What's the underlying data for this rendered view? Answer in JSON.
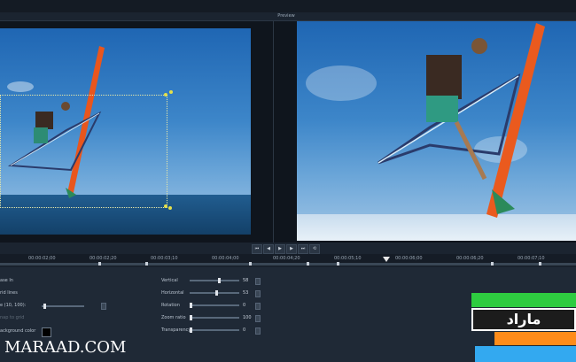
{
  "header": {
    "preview_label": "Preview"
  },
  "transport": {
    "buttons": [
      {
        "name": "go-to-start-button",
        "glyph": "⏮"
      },
      {
        "name": "prev-frame-button",
        "glyph": "◀"
      },
      {
        "name": "play-button",
        "glyph": "▶"
      },
      {
        "name": "next-frame-button",
        "glyph": "▶"
      },
      {
        "name": "go-to-end-button",
        "glyph": "⏭"
      },
      {
        "name": "loop-button",
        "glyph": "⟲"
      }
    ]
  },
  "timeline": {
    "ticks": [
      "00:00:02;00",
      "00:00:02;20",
      "00:00:03;10",
      "00:00:04;00",
      "00:00:04;20",
      "00:00:05;10",
      "00:00:06;00",
      "00:00:06;20",
      "00:00:07;10"
    ]
  },
  "left_options": {
    "ease_in": "ase In",
    "grid_lines": "rid lines",
    "grid_size": "e (10, 100):",
    "snap": "nap to grid",
    "background_color": "ackground color"
  },
  "params": [
    {
      "label": "Vertical",
      "value": "58",
      "level": 0.58
    },
    {
      "label": "Horizontal",
      "value": "53",
      "level": 0.53
    },
    {
      "label": "Rotation",
      "value": "0",
      "level": 0.0
    },
    {
      "label": "Zoom ratio",
      "value": "100",
      "level": 0.0
    },
    {
      "label": "Transparency",
      "value": "0",
      "level": 0.0
    }
  ],
  "watermark": {
    "text": "MARAAD.COM"
  },
  "logo": {
    "text": "ماراد",
    "colors": [
      "#2ecc40",
      "#1c1c1c",
      "#ff8c1a",
      "#33a9f0"
    ]
  }
}
